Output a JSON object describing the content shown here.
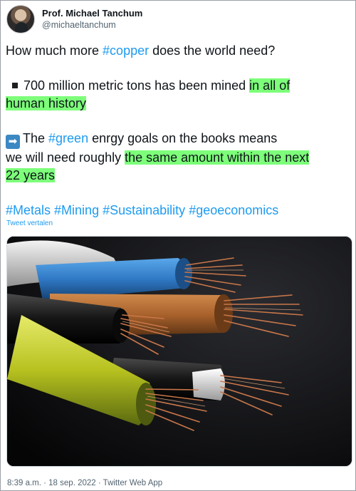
{
  "author": {
    "display_name": "Prof. Michael Tanchum",
    "handle": "@michaeltanchum"
  },
  "tweet": {
    "line1_pre": "How much more ",
    "line1_tag": "#copper",
    "line1_post": " does the world need?",
    "p2_pre": "700 million metric tons has been mined ",
    "p2_hl_a": "in all of",
    "p2_hl_b": "human history",
    "p3_pre": "The ",
    "p3_tag": "#green",
    "p3_mid": " enrgy goals on the books means",
    "p3_line2_pre": "we will need roughly ",
    "p3_hl_a": "the same amount within the next",
    "p3_hl_b": "22 years",
    "hashtags": [
      "#Metals",
      "#Mining",
      "#Sustainability",
      "#geoeconomics"
    ],
    "translate_label": "Tweet vertalen"
  },
  "media": {
    "description_icon": "copper-cables-photo",
    "cable_colors": [
      "#2f78c4",
      "#a8612b",
      "#111111",
      "#c9d12a",
      "#e8e8e8"
    ],
    "copper_color": "#c9774a"
  },
  "meta": {
    "timestamp": "8:39 a.m. · 18 sep. 2022 · Twitter Web App"
  }
}
